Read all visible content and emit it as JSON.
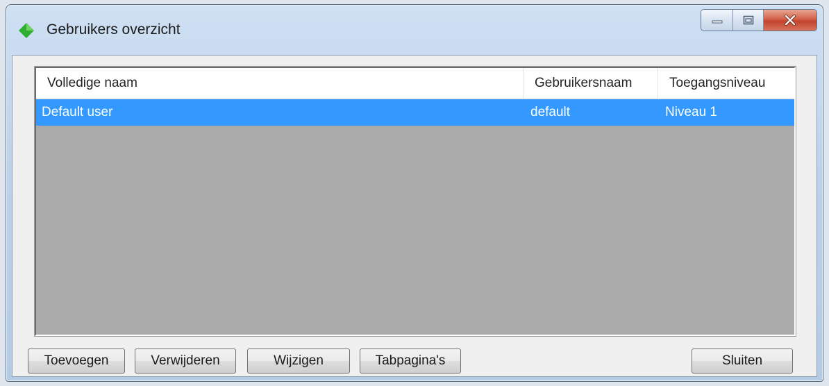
{
  "window": {
    "title": "Gebruikers overzicht",
    "app_icon": "green-diamond-icon",
    "caption_buttons": [
      "minimize-icon",
      "maximize-icon",
      "close-icon"
    ]
  },
  "grid": {
    "columns": [
      "Volledige naam",
      "Gebruikersnaam",
      "Toegangsniveau"
    ],
    "rows": [
      {
        "full_name": "Default user",
        "username": "default",
        "access_level": "Niveau 1",
        "selected": true
      }
    ],
    "selection_color": "#3399ff",
    "empty_area_color": "#ababab"
  },
  "buttons": {
    "add": "Toevoegen",
    "delete": "Verwijderen",
    "edit": "Wijzigen",
    "tab_pages": "Tabpagina's",
    "close": "Sluiten"
  }
}
